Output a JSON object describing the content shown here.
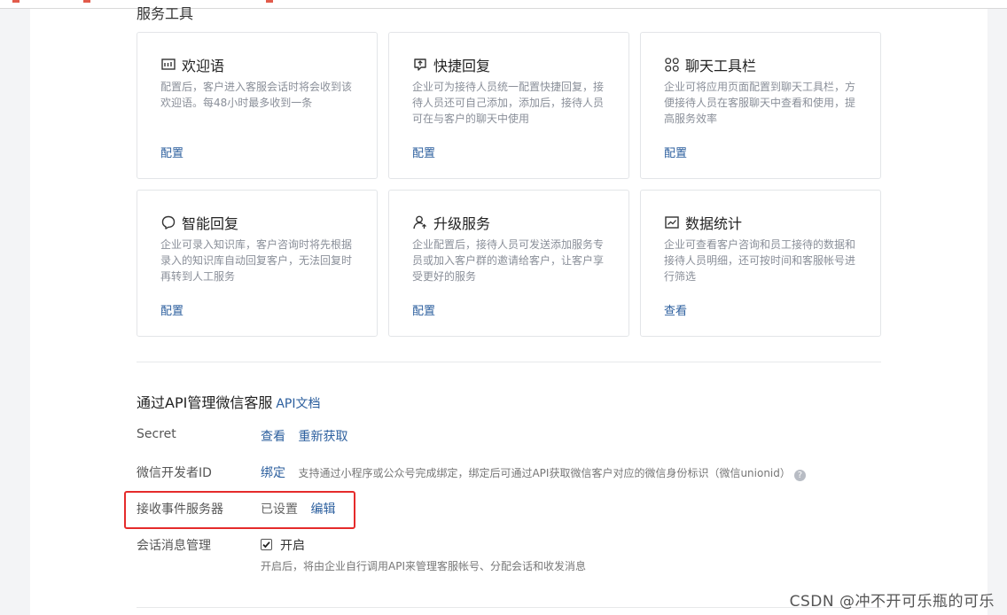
{
  "section": {
    "title_partial": "服务工具"
  },
  "cards": [
    {
      "title": "欢迎语",
      "icon": "welcome-message-icon",
      "desc": "配置后，客户进入客服会话时将会收到该欢迎语。每48小时最多收到一条",
      "link": "配置"
    },
    {
      "title": "快捷回复",
      "icon": "quick-reply-icon",
      "desc": "企业可为接待人员统一配置快捷回复，接待人员还可自己添加，添加后，接待人员可在与客户的聊天中使用",
      "link": "配置"
    },
    {
      "title": "聊天工具栏",
      "icon": "toolbar-grid-icon",
      "desc": "企业可将应用页面配置到聊天工具栏，方便接待人员在客服聊天中查看和使用，提高服务效率",
      "link": "配置"
    },
    {
      "title": "智能回复",
      "icon": "smart-reply-icon",
      "desc": "企业可录入知识库，客户咨询时将先根据录入的知识库自动回复客户，无法回复时再转到人工服务",
      "link": "配置"
    },
    {
      "title": "升级服务",
      "icon": "upgrade-service-icon",
      "desc": "企业配置后，接待人员可发送添加服务专员或加入客户群的邀请给客户，让客户享受更好的服务",
      "link": "配置"
    },
    {
      "title": "数据统计",
      "icon": "data-chart-icon",
      "desc": "企业可查看客户咨询和员工接待的数据和接待人员明细，还可按时间和客服帐号进行筛选",
      "link": "查看"
    }
  ],
  "api": {
    "title": "通过API管理微信客服",
    "doc_link": "API文档",
    "secret": {
      "label": "Secret",
      "view": "查看",
      "refresh": "重新获取"
    },
    "dev_id": {
      "label": "微信开发者ID",
      "bind": "绑定",
      "hint": "支持通过小程序或公众号完成绑定，绑定后可通过API获取微信客户对应的微信身份标识（微信unionid）",
      "help": "?"
    },
    "event_server": {
      "label": "接收事件服务器",
      "status": "已设置",
      "edit": "编辑"
    },
    "session_mgmt": {
      "label": "会话消息管理",
      "checked": true,
      "enable": "开启",
      "hint": "开启后，将由企业自行调用API来管理客服帐号、分配会话和收发消息"
    }
  },
  "watermark": "CSDN @冲不开可乐瓶的可乐",
  "colors": {
    "link": "#2c5f9e",
    "highlight": "#e52b2b"
  }
}
